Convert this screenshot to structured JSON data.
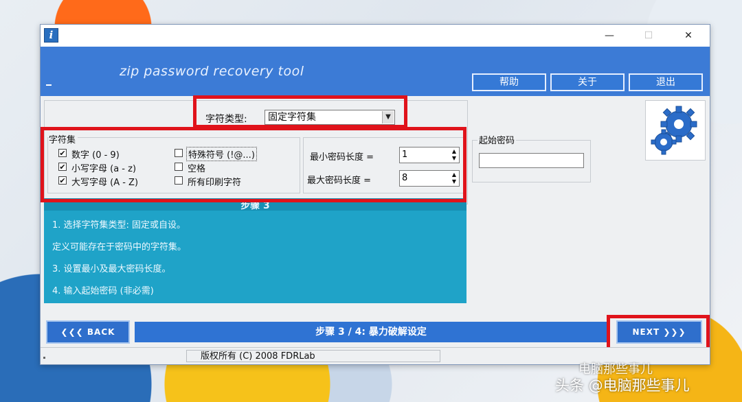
{
  "window": {
    "app_icon_glyph": "i",
    "minimize_glyph": "—",
    "maximize_glyph": "☐",
    "close_glyph": "✕"
  },
  "banner": {
    "title": "zip password recovery tool",
    "buttons": [
      "帮助",
      "关于",
      "退出"
    ]
  },
  "charset_type": {
    "label": "字符类型:",
    "selected": "固定字符集",
    "dropdown_glyph": "▼"
  },
  "charset": {
    "title": "字符集",
    "options": [
      {
        "label": "数字 (0 - 9)",
        "checked": true
      },
      {
        "label": "小写字母 (a - z)",
        "checked": true
      },
      {
        "label": "大写字母 (A - Z)",
        "checked": true
      },
      {
        "label": "特殊符号 (!@...)",
        "checked": false
      },
      {
        "label": "空格",
        "checked": false
      },
      {
        "label": "所有印刷字符",
        "checked": false
      }
    ]
  },
  "length": {
    "min_label": "最小密码长度 =",
    "min_value": "1",
    "max_label": "最大密码长度 =",
    "max_value": "8"
  },
  "start_password": {
    "label": "起始密码",
    "value": ""
  },
  "steps": {
    "title": "步骤 3",
    "lines": [
      "1. 选择字符集类型: 固定或自设。",
      "定义可能存在于密码中的字符集。",
      "3. 设置最小及最大密码长度。",
      "4. 输入起始密码 (非必需)"
    ]
  },
  "nav": {
    "back_label": "BACK",
    "back_arrows": "❮❮❮",
    "progress_text": "步骤 3 / 4: 暴力破解设定",
    "next_label": "NEXT",
    "next_arrows": "❯❯❯"
  },
  "status": {
    "copyright": "版权所有 (C) 2008 FDRLab"
  },
  "watermark": {
    "small": "电脑那些事儿",
    "main": "头条 @电脑那些事儿"
  },
  "colors": {
    "banner": "#3c7bd6",
    "step_box": "#1fa3c8",
    "highlight": "#e0131b"
  }
}
